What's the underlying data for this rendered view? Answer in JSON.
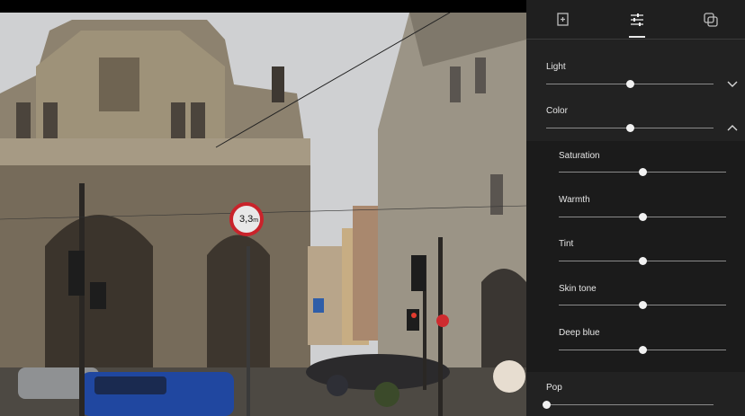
{
  "panel": {
    "tabs": [
      {
        "name": "crop",
        "icon": "crop-rotate-icon"
      },
      {
        "name": "adjust",
        "icon": "sliders-icon",
        "active": true
      },
      {
        "name": "filters",
        "icon": "filter-icon"
      }
    ],
    "sections": {
      "light": {
        "label": "Light",
        "value": 0.5,
        "expanded": false
      },
      "color": {
        "label": "Color",
        "value": 0.5,
        "expanded": true
      },
      "pop": {
        "label": "Pop",
        "value": 0.0
      }
    },
    "color_sub": [
      {
        "label": "Saturation",
        "value": 0.5
      },
      {
        "label": "Warmth",
        "value": 0.5
      },
      {
        "label": "Tint",
        "value": 0.5
      },
      {
        "label": "Skin tone",
        "value": 0.5
      },
      {
        "label": "Deep blue",
        "value": 0.5
      }
    ]
  },
  "photo": {
    "sign_text": "3,3",
    "sign_unit": "m"
  },
  "colors": {
    "panel_bg": "#222222",
    "sub_bg": "#1b1b1b",
    "accent": "#f1f1f1"
  }
}
